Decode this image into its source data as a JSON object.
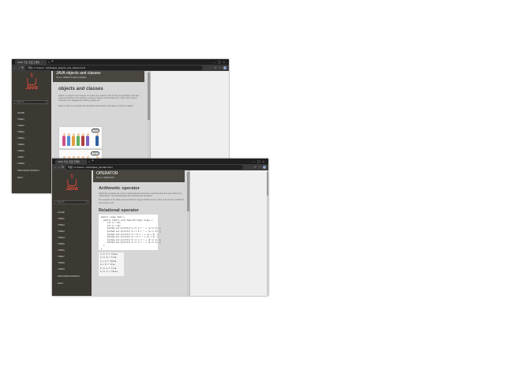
{
  "colors": {
    "java_red": "#e14b3b",
    "sidebar_bg": "#3a3630",
    "header_box": "#4a4640"
  },
  "window_back": {
    "tab": {
      "title": "JAVA 기초 프로그래밍"
    },
    "url": "파일 | C:/Users/.../JAVA/java_objects_and_classes.html",
    "logo_text": "Java",
    "search_placeholder": "Search",
    "menu": [
      "HOME",
      "TIME1",
      "TIME2",
      "TIME3",
      "TIME4",
      "TIME5",
      "TIME6",
      "TIME7",
      "TIME8",
      "PROGRAM WORKS",
      "INFO"
    ],
    "header": {
      "title": "JAVA objects and classes",
      "subtitle": "Home / OBJECTS AND CLASSES"
    },
    "article": {
      "heading": "objects and classes",
      "para1": "Object: An object is an instance of a class.(Any object is said to have a type(class)), and has state and behavior. For example, a dog is an object, and its states are: color, name, breed; behaviors are: wagging tail, barking, eating, etc.",
      "para2": "Class: A class is a template that describes the behavior and state of a class of objects."
    },
    "figure": {
      "label_top": "class",
      "label_bottom": "object"
    }
  },
  "window_front": {
    "tab": {
      "title": "JAVA 기초 프로그래밍"
    },
    "url": "파일 | C:/Users/.../JAVA/java_operator.html",
    "logo_text": "Java",
    "search_placeholder": "Search",
    "menu": [
      "HOME",
      "TIME1",
      "TIME2",
      "TIME3",
      "TIME4",
      "TIME5",
      "TIME6",
      "TIME7",
      "TIME8",
      "TIME9",
      "PROGRAM WORKS",
      "INFO"
    ],
    "header": {
      "title": "OPERATOR",
      "subtitle": "Home / OPERATOR"
    },
    "article": {
      "h1": "Arithmetic operator",
      "para1": "Arithmetic operators are used in mathematical expressions, and they have the same effect as in mathematics. The following table lists all arithmetic operators.",
      "para2": "The example in the table assumes that the integer variable A has a value of 10 and the variable B has a value of 20.",
      "h2": "Relational operator"
    },
    "code": [
      "public class Test {",
      "",
      "  public static void main(String[] args) {",
      "     int a = 10;",
      "     int b = 20;",
      "     System.out.println(\"a == b = \" + (a == b) );",
      "     System.out.println(\"a != b = \" + (a != b) );",
      "     System.out.println(\"a > b = \" + (a > b) );",
      "     System.out.println(\"a < b = \" + (a < b) );",
      "     System.out.println(\"b >= a = \" + (b >= a) );",
      "     System.out.println(\"b <= a = \" + (b <= a) );",
      "  }",
      "}"
    ],
    "output": [
      "a == b = false",
      "a != b = true",
      "a > b = false",
      "a < b = true",
      "b >= a = true",
      "b <= a = false"
    ]
  }
}
